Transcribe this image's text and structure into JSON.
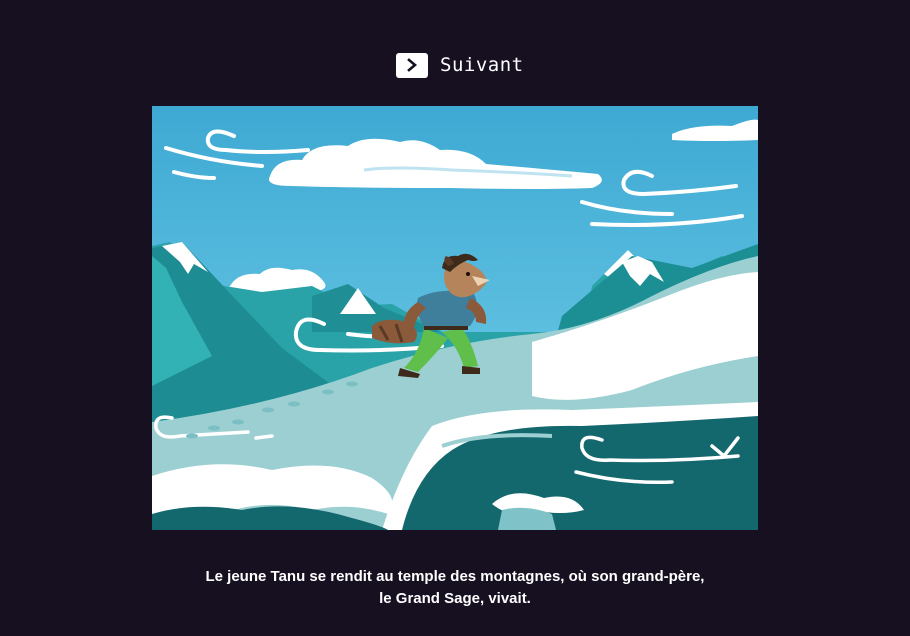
{
  "navigation": {
    "next_label": "Suivant",
    "next_icon": "chevron-right-icon"
  },
  "story": {
    "caption_line1": "Le jeune Tanu se rendit au temple des montagnes, où son grand-père,",
    "caption_line2": "le Grand Sage, vivait."
  },
  "colors": {
    "background": "#171021",
    "sky": "#46b0d6",
    "mountain": "#1f8f95",
    "snow": "#ffffff",
    "lake": "#13686e"
  }
}
